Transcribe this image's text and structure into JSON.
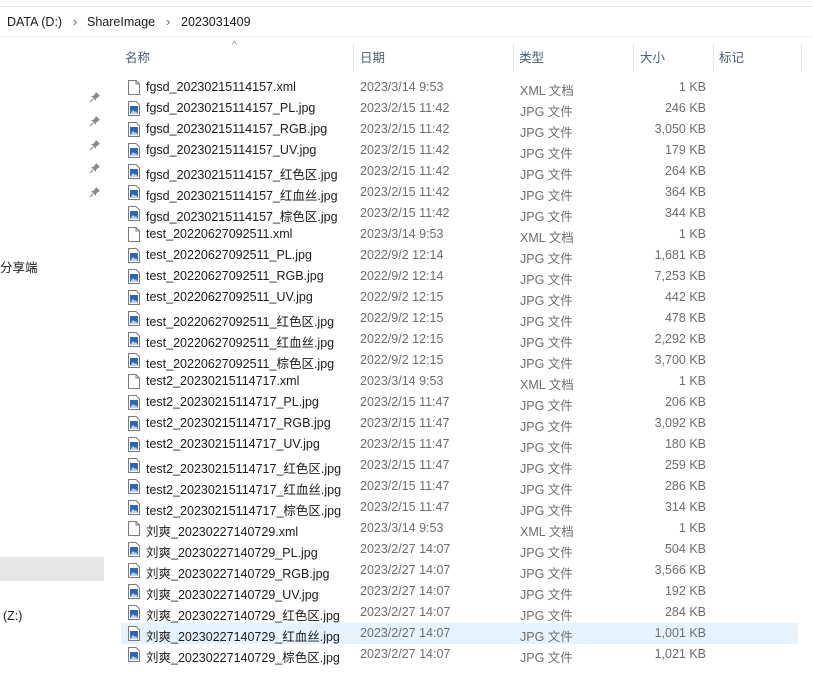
{
  "breadcrumb": {
    "drive": "DATA (D:)",
    "folder1": "ShareImage",
    "folder2": "2023031409"
  },
  "nav": {
    "item_share": "分享端",
    "item_z": "(Z:)"
  },
  "columns": {
    "name": "名称",
    "date": "日期",
    "type": "类型",
    "size": "大小",
    "tag": "标记"
  },
  "files": [
    {
      "name": "fgsd_20230215114157.xml",
      "date": "2023/3/14 9:53",
      "type": "XML 文档",
      "size": "1 KB",
      "icon": "xml-file-icon"
    },
    {
      "name": "fgsd_20230215114157_PL.jpg",
      "date": "2023/2/15 11:42",
      "type": "JPG 文件",
      "size": "246 KB",
      "icon": "image-file-icon"
    },
    {
      "name": "fgsd_20230215114157_RGB.jpg",
      "date": "2023/2/15 11:42",
      "type": "JPG 文件",
      "size": "3,050 KB",
      "icon": "image-file-icon"
    },
    {
      "name": "fgsd_20230215114157_UV.jpg",
      "date": "2023/2/15 11:42",
      "type": "JPG 文件",
      "size": "179 KB",
      "icon": "image-file-icon"
    },
    {
      "name": "fgsd_20230215114157_红色区.jpg",
      "date": "2023/2/15 11:42",
      "type": "JPG 文件",
      "size": "264 KB",
      "icon": "image-file-icon"
    },
    {
      "name": "fgsd_20230215114157_红血丝.jpg",
      "date": "2023/2/15 11:42",
      "type": "JPG 文件",
      "size": "364 KB",
      "icon": "image-file-icon"
    },
    {
      "name": "fgsd_20230215114157_棕色区.jpg",
      "date": "2023/2/15 11:42",
      "type": "JPG 文件",
      "size": "344 KB",
      "icon": "image-file-icon"
    },
    {
      "name": "test_20220627092511.xml",
      "date": "2023/3/14 9:53",
      "type": "XML 文档",
      "size": "1 KB",
      "icon": "xml-file-icon"
    },
    {
      "name": "test_20220627092511_PL.jpg",
      "date": "2022/9/2 12:14",
      "type": "JPG 文件",
      "size": "1,681 KB",
      "icon": "image-file-icon"
    },
    {
      "name": "test_20220627092511_RGB.jpg",
      "date": "2022/9/2 12:14",
      "type": "JPG 文件",
      "size": "7,253 KB",
      "icon": "image-file-icon"
    },
    {
      "name": "test_20220627092511_UV.jpg",
      "date": "2022/9/2 12:15",
      "type": "JPG 文件",
      "size": "442 KB",
      "icon": "image-file-icon"
    },
    {
      "name": "test_20220627092511_红色区.jpg",
      "date": "2022/9/2 12:15",
      "type": "JPG 文件",
      "size": "478 KB",
      "icon": "image-file-icon"
    },
    {
      "name": "test_20220627092511_红血丝.jpg",
      "date": "2022/9/2 12:15",
      "type": "JPG 文件",
      "size": "2,292 KB",
      "icon": "image-file-icon"
    },
    {
      "name": "test_20220627092511_棕色区.jpg",
      "date": "2022/9/2 12:15",
      "type": "JPG 文件",
      "size": "3,700 KB",
      "icon": "image-file-icon"
    },
    {
      "name": "test2_20230215114717.xml",
      "date": "2023/3/14 9:53",
      "type": "XML 文档",
      "size": "1 KB",
      "icon": "xml-file-icon"
    },
    {
      "name": "test2_20230215114717_PL.jpg",
      "date": "2023/2/15 11:47",
      "type": "JPG 文件",
      "size": "206 KB",
      "icon": "image-file-icon"
    },
    {
      "name": "test2_20230215114717_RGB.jpg",
      "date": "2023/2/15 11:47",
      "type": "JPG 文件",
      "size": "3,092 KB",
      "icon": "image-file-icon"
    },
    {
      "name": "test2_20230215114717_UV.jpg",
      "date": "2023/2/15 11:47",
      "type": "JPG 文件",
      "size": "180 KB",
      "icon": "image-file-icon"
    },
    {
      "name": "test2_20230215114717_红色区.jpg",
      "date": "2023/2/15 11:47",
      "type": "JPG 文件",
      "size": "259 KB",
      "icon": "image-file-icon"
    },
    {
      "name": "test2_20230215114717_红血丝.jpg",
      "date": "2023/2/15 11:47",
      "type": "JPG 文件",
      "size": "286 KB",
      "icon": "image-file-icon"
    },
    {
      "name": "test2_20230215114717_棕色区.jpg",
      "date": "2023/2/15 11:47",
      "type": "JPG 文件",
      "size": "314 KB",
      "icon": "image-file-icon"
    },
    {
      "name": "刘爽_20230227140729.xml",
      "date": "2023/3/14 9:53",
      "type": "XML 文档",
      "size": "1 KB",
      "icon": "xml-file-icon"
    },
    {
      "name": "刘爽_20230227140729_PL.jpg",
      "date": "2023/2/27 14:07",
      "type": "JPG 文件",
      "size": "504 KB",
      "icon": "image-file-icon"
    },
    {
      "name": "刘爽_20230227140729_RGB.jpg",
      "date": "2023/2/27 14:07",
      "type": "JPG 文件",
      "size": "3,566 KB",
      "icon": "image-file-icon"
    },
    {
      "name": "刘爽_20230227140729_UV.jpg",
      "date": "2023/2/27 14:07",
      "type": "JPG 文件",
      "size": "192 KB",
      "icon": "image-file-icon"
    },
    {
      "name": "刘爽_20230227140729_红色区.jpg",
      "date": "2023/2/27 14:07",
      "type": "JPG 文件",
      "size": "284 KB",
      "icon": "image-file-icon"
    },
    {
      "name": "刘爽_20230227140729_红血丝.jpg",
      "date": "2023/2/27 14:07",
      "type": "JPG 文件",
      "size": "1,001 KB",
      "icon": "image-file-icon",
      "selected": true
    },
    {
      "name": "刘爽_20230227140729_棕色区.jpg",
      "date": "2023/2/27 14:07",
      "type": "JPG 文件",
      "size": "1,021 KB",
      "icon": "image-file-icon"
    }
  ],
  "colors": {
    "header_text": "#4c607a",
    "selected_row": "#e5f3ff",
    "nav_selected": "#e5e5e5",
    "image_icon_blue": "#2b67b3"
  }
}
